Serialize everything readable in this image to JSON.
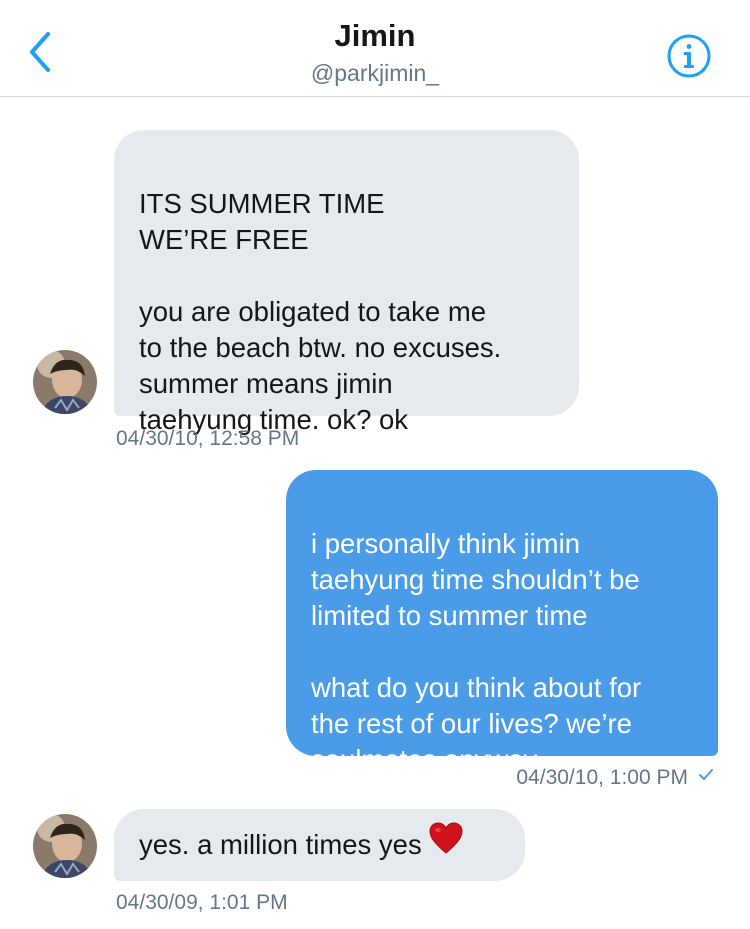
{
  "header": {
    "name": "Jimin",
    "handle": "@parkjimin_",
    "back_icon": "chevron-left-icon",
    "info_icon": "info-icon",
    "accent": "#1da1f2"
  },
  "messages": [
    {
      "direction": "incoming",
      "text": "ITS SUMMER TIME\nWE’RE FREE\n\nyou are obligated to take me\nto the beach btw. no excuses.\nsummer means jimin\ntaehyung time. ok? ok",
      "timestamp": "04/30/10, 12:58 PM"
    },
    {
      "direction": "outgoing",
      "text": "i personally think jimin\ntaehyung time shouldn’t be\nlimited to summer time\n\nwhat do you think about for\nthe rest of our lives? we’re\nsoulmates anyway",
      "timestamp": "04/30/10, 1:00 PM",
      "status_icon": "checkmark-icon"
    },
    {
      "direction": "incoming",
      "text": "yes. a million times yes",
      "emoji": "heart-emoji",
      "timestamp": "04/30/09, 1:01 PM"
    }
  ],
  "colors": {
    "incoming_bubble": "#e6e9ed",
    "outgoing_bubble": "#4a9ce8",
    "timestamp": "#657786"
  }
}
